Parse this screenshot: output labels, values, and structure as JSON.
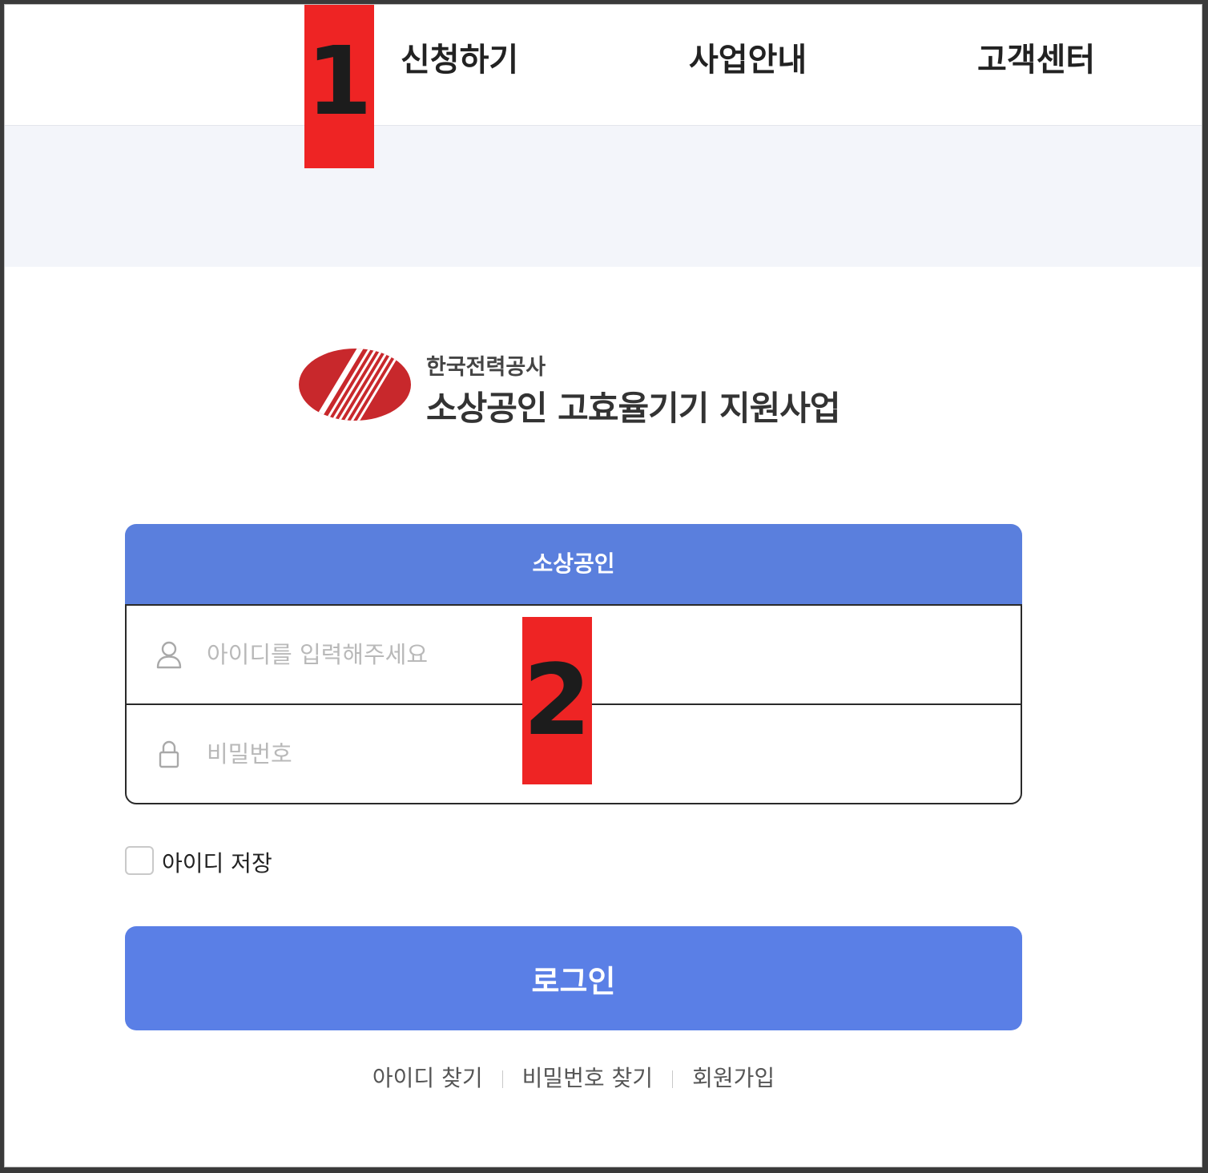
{
  "nav": {
    "items": [
      {
        "label": "신청하기"
      },
      {
        "label": "사업안내"
      },
      {
        "label": "고객센터"
      }
    ]
  },
  "markers": [
    "1",
    "2"
  ],
  "logo": {
    "company": "한국전력공사",
    "program": "소상공인 고효율기기 지원사업",
    "emblem_colors": [
      "#c8282c",
      "#ffffff"
    ]
  },
  "login": {
    "user_type_tab": "소상공인",
    "id_placeholder": "아이디를 입력해주세요",
    "password_placeholder": "비밀번호",
    "save_id_label": "아이디 저장",
    "save_id_checked": false,
    "submit_label": "로그인"
  },
  "links": [
    {
      "label": "아이디 찾기"
    },
    {
      "label": "비밀번호 찾기"
    },
    {
      "label": "회원가입"
    }
  ],
  "icons": {
    "id_field": "user-icon",
    "password_field": "lock-icon"
  },
  "colors": {
    "accent": "#5a7fe6",
    "tab": "#5a7fdd",
    "marker": "#ee2424",
    "banner": "#f3f5fa"
  }
}
